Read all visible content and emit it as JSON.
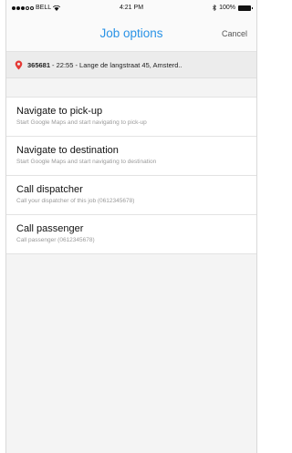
{
  "status_bar": {
    "carrier": "BELL",
    "time": "4:21 PM",
    "battery": "100%"
  },
  "nav": {
    "title": "Job options",
    "cancel": "Cancel"
  },
  "job": {
    "number": "365681",
    "details": "- 22:55 - Lange de langstraat 45, Amsterd.."
  },
  "options": [
    {
      "title": "Navigate to pick-up",
      "subtitle": "Start Google Maps and start navigating to pick-up"
    },
    {
      "title": "Navigate to destination",
      "subtitle": "Start Google Maps and start navigating to destination"
    },
    {
      "title": "Call dispatcher",
      "subtitle": "Call your dispatcher of this job (0612345678)"
    },
    {
      "title": "Call passenger",
      "subtitle": "Call passenger (0612345678)"
    }
  ],
  "colors": {
    "accent": "#2a93e6",
    "pin": "#e53935"
  }
}
